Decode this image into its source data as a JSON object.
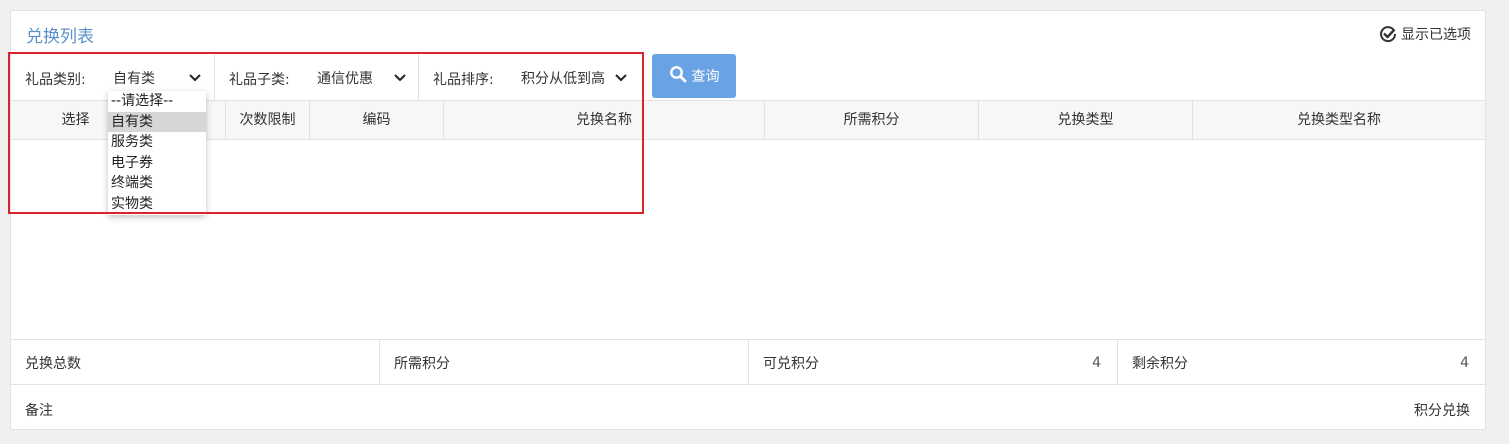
{
  "panel": {
    "title": "兑换列表",
    "show_selected_label": "显示已选项"
  },
  "filters": {
    "category": {
      "label": "礼品类别:",
      "value": "自有类"
    },
    "subcategory": {
      "label": "礼品子类:",
      "value": "通信优惠"
    },
    "sort": {
      "label": "礼品排序:",
      "value": "积分从低到高"
    }
  },
  "search_button": {
    "label": "查询"
  },
  "dropdown": {
    "options": [
      "--请选择--",
      "自有类",
      "服务类",
      "电子券",
      "终端类",
      "实物类"
    ],
    "selected": "自有类"
  },
  "table": {
    "columns": [
      "选择",
      "",
      "次数限制",
      "编码",
      "兑换名称",
      "所需积分",
      "兑换类型",
      "兑换类型名称"
    ]
  },
  "summary": {
    "total_label": "兑换总数",
    "total_value": "",
    "required_label": "所需积分",
    "required_value": "",
    "available_label": "可兑积分",
    "available_value": "4",
    "remaining_label": "剩余积分",
    "remaining_value": "4"
  },
  "footer": {
    "remark_label": "备注",
    "exchange_label": "积分兑换"
  },
  "colors": {
    "accent": "#6aa3e3",
    "title": "#5b8fc9",
    "highlight_border": "#d9242e"
  },
  "icons": [
    "check-circle-icon",
    "chevron-down-icon",
    "search-icon"
  ]
}
